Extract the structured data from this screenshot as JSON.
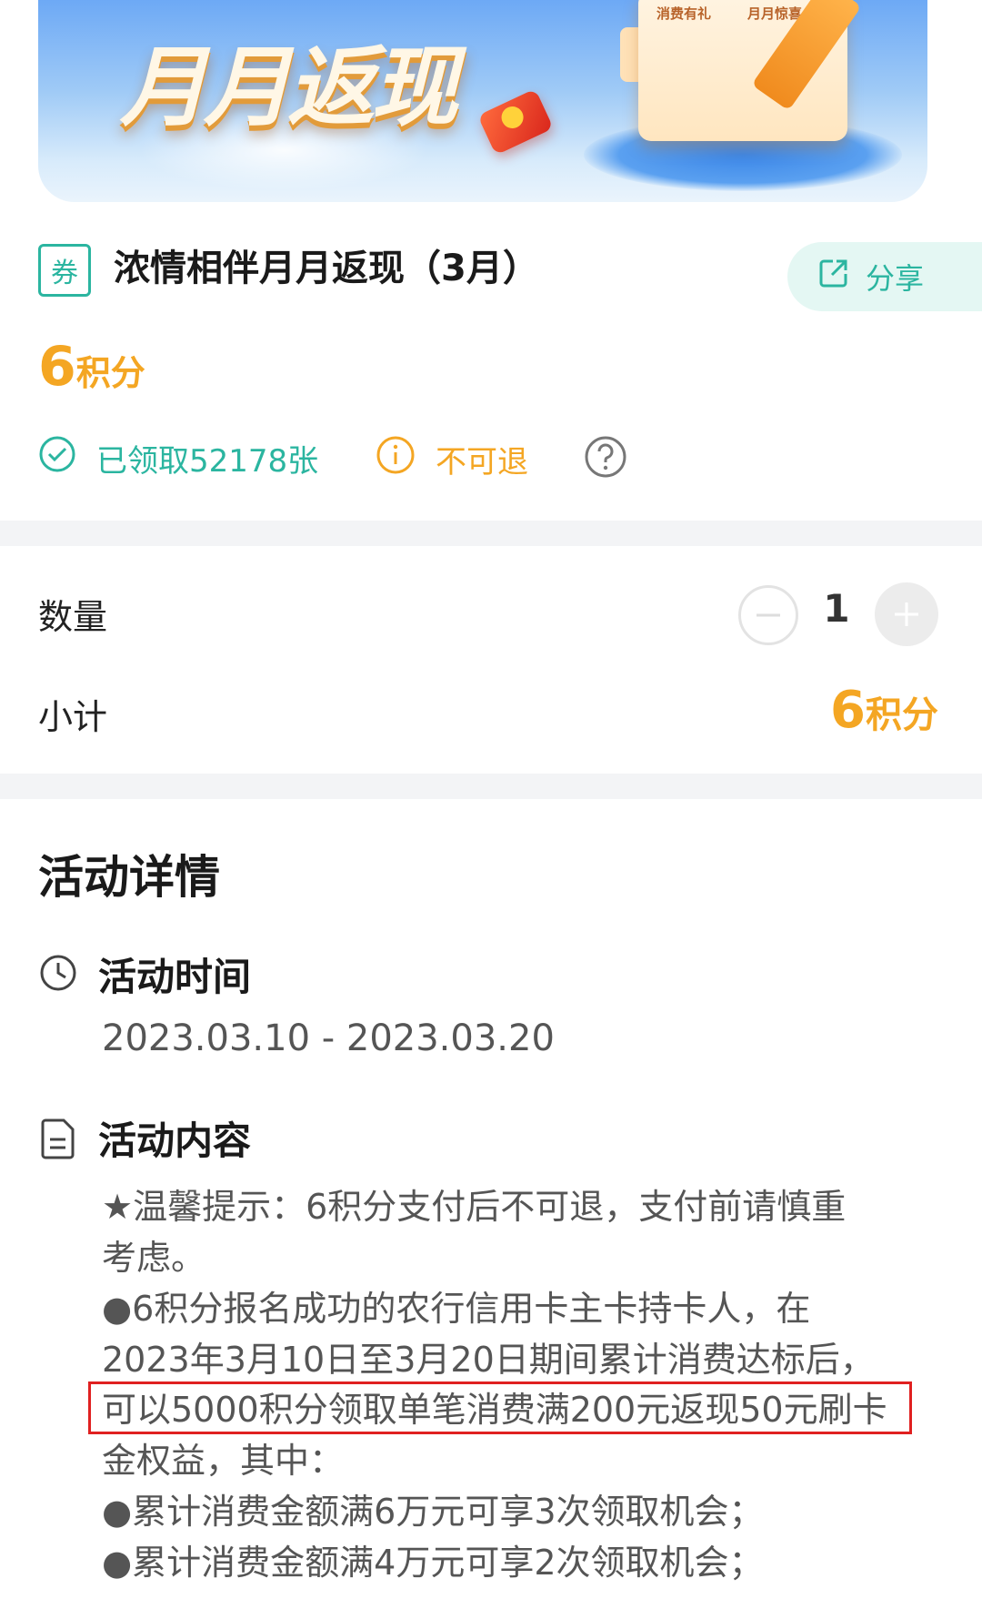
{
  "banner": {
    "title": "月月返现",
    "doc_labels": [
      "消费有礼",
      "月月惊喜"
    ]
  },
  "product": {
    "tag": "券",
    "title": "浓情相伴月月返现（3月）",
    "share_label": "分享",
    "price_value": "6",
    "price_unit": "积分",
    "claimed_text": "已领取52178张",
    "refund_text": "不可退"
  },
  "quantity": {
    "label": "数量",
    "value": "1"
  },
  "subtotal": {
    "label": "小计",
    "value": "6",
    "unit": "积分"
  },
  "details": {
    "title": "活动详情",
    "time_heading": "活动时间",
    "time_range": "2023.03.10 - 2023.03.20",
    "content_heading": "活动内容",
    "lines": [
      "★温馨提示：6积分支付后不可退，支付前请慎重",
      "考虑。",
      "●6积分报名成功的农行信用卡主卡持卡人，在",
      "2023年3月10日至3月20日期间累计消费达标后，",
      "可以5000积分领取单笔消费满200元返现50元刷卡",
      "金权益，其中：",
      "●累计消费金额满6万元可享3次领取机会；",
      "●累计消费金额满4万元可享2次领取机会；"
    ]
  },
  "colors": {
    "teal": "#2bb5a0",
    "orange": "#f4a623",
    "highlight": "#e02020"
  },
  "icons": [
    "share-icon",
    "check-circle-icon",
    "info-icon",
    "help-icon",
    "minus-icon",
    "plus-icon",
    "clock-icon",
    "document-icon"
  ]
}
